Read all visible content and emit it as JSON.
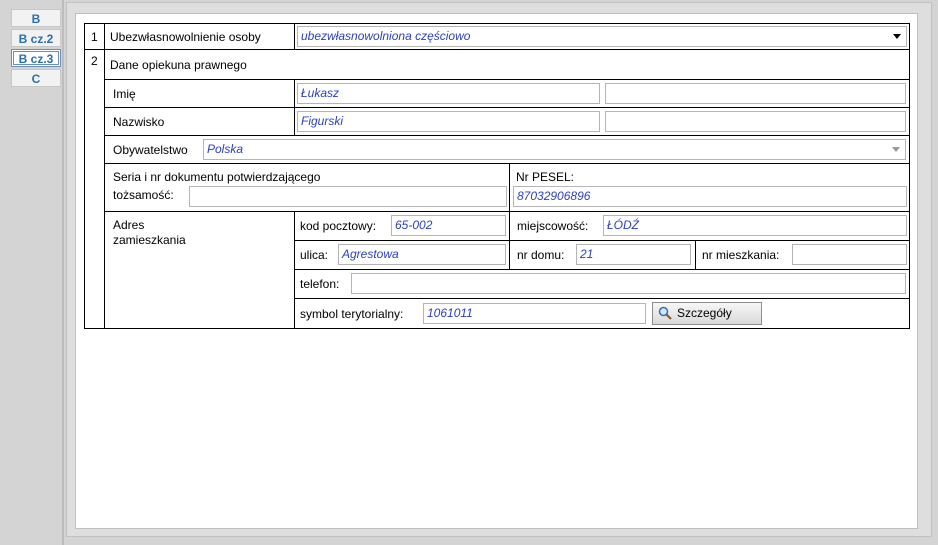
{
  "tabs": [
    {
      "label": "B"
    },
    {
      "label": "B cz.2"
    },
    {
      "label": "B cz.3"
    },
    {
      "label": "C"
    }
  ],
  "row1": {
    "number": "1",
    "label": "Ubezwłasnowolnienie osoby",
    "value": "ubezwłasnowolniona częściowo"
  },
  "row2": {
    "number": "2",
    "heading": "Dane opiekuna prawnego",
    "imie_label": "Imię",
    "imie_value": "Łukasz",
    "imie_value2": "",
    "nazwisko_label": "Nazwisko",
    "nazwisko_value": "Figurski",
    "nazwisko_value2": "",
    "obywatelstwo_label": "Obywatelstwo",
    "obywatelstwo_value": "Polska",
    "dokument_label_line1": "Seria i nr dokumentu potwierdzającego",
    "dokument_label_line2": "tożsamość:",
    "dokument_value": "",
    "pesel_label": "Nr PESEL:",
    "pesel_value": "87032906896"
  },
  "address": {
    "label_line1": "Adres",
    "label_line2": "zamieszkania",
    "kod_label": "kod pocztowy:",
    "kod_value": "65-002",
    "miejscowosc_label": "miejscowość:",
    "miejscowosc_value": "ŁÓDŹ",
    "ulica_label": "ulica:",
    "ulica_value": "Agrestowa",
    "nr_domu_label": "nr domu:",
    "nr_domu_value": "21",
    "nr_mieszkania_label": "nr mieszkania:",
    "nr_mieszkania_value": "",
    "telefon_label": "telefon:",
    "telefon_value": "",
    "symbol_label": "symbol terytorialny:",
    "symbol_value": "1061011",
    "details_button": "Szczegóły"
  },
  "icons": {
    "details": "magnifier-icon",
    "dropdown": "chevron-down-icon"
  }
}
